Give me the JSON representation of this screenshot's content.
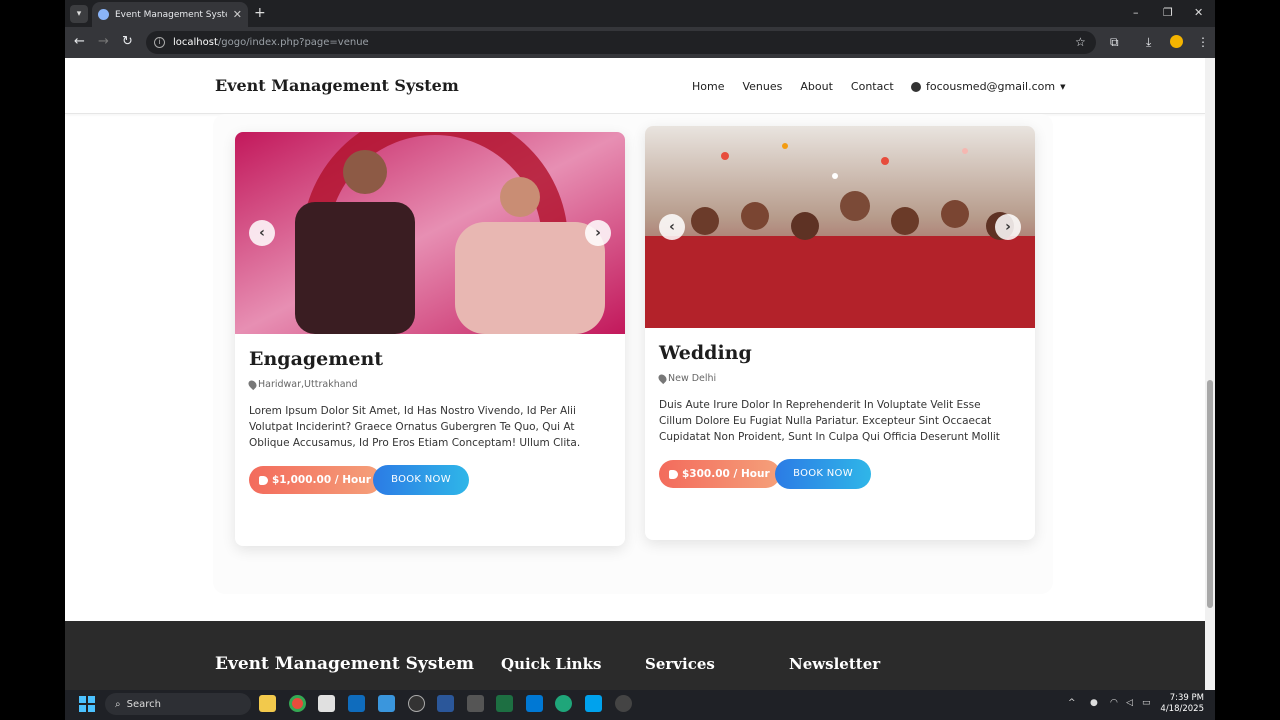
{
  "browser": {
    "tab_title": "Event Management System",
    "url_host": "localhost",
    "url_path": "/gogo/index.php?page=venue"
  },
  "site": {
    "brand": "Event Management System",
    "nav": [
      "Home",
      "Venues",
      "About",
      "Contact"
    ],
    "user_email": "focousmed@gmail.com"
  },
  "venues": [
    {
      "title": "Engagement",
      "location": "Haridwar,Uttrakhand",
      "description": "Lorem Ipsum Dolor Sit Amet, Id Has Nostro Vivendo, Id Per Alii Volutpat Inciderint? Graece Ornatus Gubergren Te Quo, Qui At Oblique Accusamus, Id Pro Eros Etiam Conceptam! Ullum Clita.",
      "price": "$1,000.00 / Hour",
      "book_label": "BOOK NOW"
    },
    {
      "title": "Wedding",
      "location": "New Delhi",
      "description": "Duis Aute Irure Dolor In Reprehenderit In Voluptate Velit Esse Cillum Dolore Eu Fugiat Nulla Pariatur. Excepteur Sint Occaecat Cupidatat Non Proident, Sunt In Culpa Qui Officia Deserunt Mollit Anim Id Est Laborum.",
      "price": "$300.00 / Hour",
      "book_label": "BOOK NOW"
    }
  ],
  "footer": {
    "brand": "Event Management System",
    "quick_links": "Quick Links",
    "services": "Services",
    "newsletter": "Newsletter"
  },
  "taskbar": {
    "search_label": "Search",
    "time": "7:39 PM",
    "date": "4/18/2025"
  },
  "colors": {
    "price_gradient_start": "#f36b5c",
    "book_gradient_start": "#2c7be5",
    "footer_bg": "#2b2b2b"
  }
}
